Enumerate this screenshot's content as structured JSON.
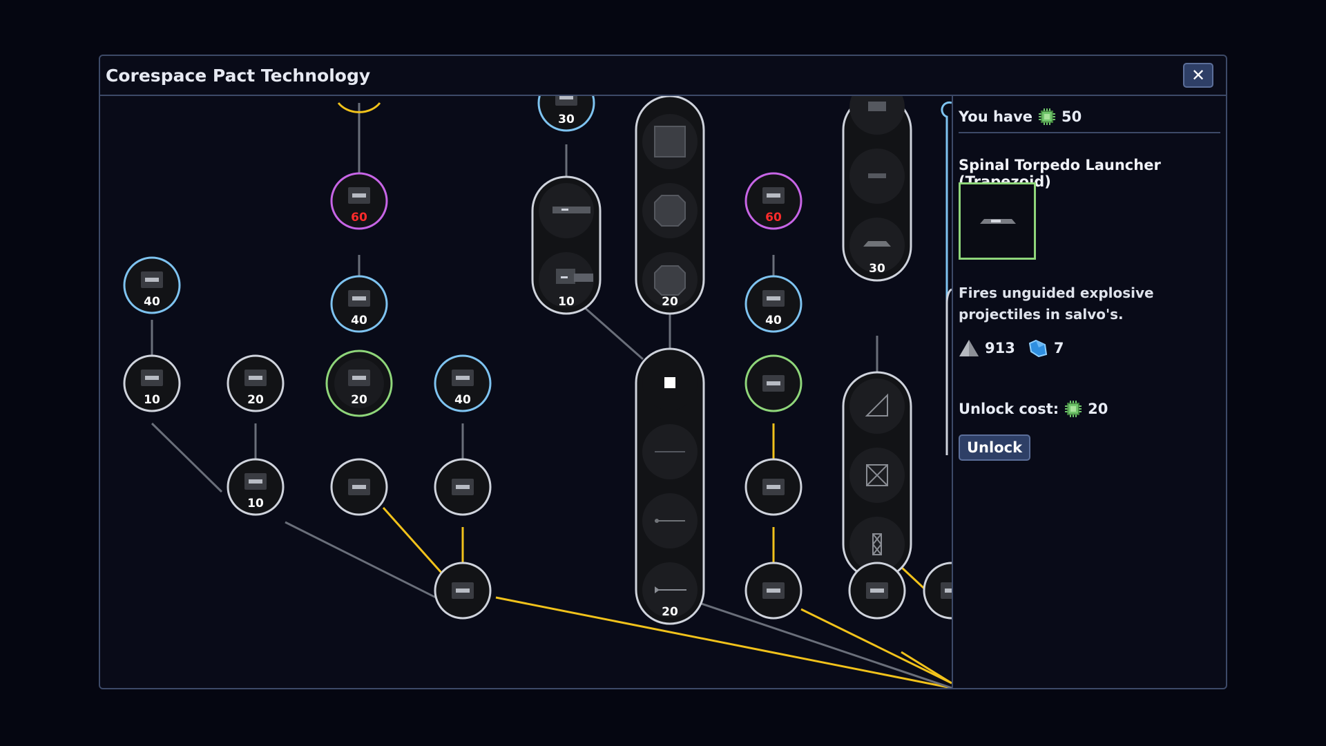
{
  "window": {
    "title": "Corespace Pact Technology",
    "close_label": "✕"
  },
  "side": {
    "you_have_label": "You have",
    "you_have_value": "50",
    "item_title": "Spinal Torpedo Launcher (Trapezoid)",
    "description": "Fires unguided explosive projectiles in salvo's.",
    "stat_mass": "913",
    "stat_crystal": "7",
    "unlock_cost_label": "Unlock cost:",
    "unlock_cost_value": "20",
    "unlock_button": "Unlock"
  },
  "tree": {
    "colors": {
      "blue": "#7ec3f0",
      "purple": "#c765e6",
      "green": "#8fd67a",
      "white": "#cfd3dc",
      "gold": "#f1c21b",
      "gray": "#6a6f7a",
      "red_cost": "#ff2b2b"
    },
    "nodes": [
      {
        "id": "n40a",
        "icon": "gun-barrel-icon",
        "cost": "40",
        "ring": "blue"
      },
      {
        "id": "n10a",
        "icon": "blaster-icon",
        "cost": "10",
        "ring": "white"
      },
      {
        "id": "n20a",
        "icon": "hex-turret-icon",
        "cost": "20",
        "ring": "white"
      },
      {
        "id": "n10b",
        "icon": "cannon-mount-icon",
        "cost": "10",
        "ring": "white"
      },
      {
        "id": "n60a",
        "icon": "heavy-turret-icon",
        "cost": "60",
        "ring": "purple",
        "cost_color": "red"
      },
      {
        "id": "n40b",
        "icon": "armored-turret-icon",
        "cost": "40",
        "ring": "blue"
      },
      {
        "id": "n20sel",
        "icon": "trapezoid-launcher-icon",
        "cost": "20",
        "ring": "green"
      },
      {
        "id": "nlaunch",
        "icon": "launcher-icon",
        "cost": "",
        "ring": "white"
      },
      {
        "id": "n40c",
        "icon": "rail-turret-icon",
        "cost": "40",
        "ring": "blue"
      },
      {
        "id": "ncannon",
        "icon": "block-cannon-icon",
        "cost": "",
        "ring": "white"
      },
      {
        "id": "nhub",
        "icon": "core-hub-icon",
        "cost": "",
        "ring": "white"
      },
      {
        "id": "n30top",
        "icon": "beam-icon",
        "cost": "30",
        "ring": "blue"
      },
      {
        "id": "n60b",
        "icon": "grate-icon",
        "cost": "60",
        "ring": "purple",
        "cost_color": "red"
      },
      {
        "id": "n40d",
        "icon": "vent-icon",
        "cost": "40",
        "ring": "blue"
      },
      {
        "id": "ngreen2",
        "icon": "bracket-icon",
        "cost": "",
        "ring": "green"
      },
      {
        "id": "nslot",
        "icon": "slot-icon",
        "cost": "",
        "ring": "white"
      },
      {
        "id": "nclamp",
        "icon": "clamp-icon",
        "cost": "",
        "ring": "white"
      },
      {
        "id": "ncross",
        "icon": "crosshair-icon",
        "cost": "",
        "ring": "white"
      },
      {
        "id": "nsquare",
        "icon": "square-icon",
        "cost": "",
        "ring": "white"
      }
    ],
    "pills": [
      {
        "id": "p-beams",
        "icons": [
          "long-beam-icon",
          "short-beam-icon"
        ],
        "cost": "10"
      },
      {
        "id": "p-armor",
        "icons": [
          "plate-square-icon",
          "plate-octagon-cross-icon",
          "plate-octagon-icon"
        ],
        "cost": "20"
      },
      {
        "id": "p-top",
        "icons": [
          "plate-icon",
          "dash-icon",
          "trapezoid-plate-icon"
        ],
        "cost": "30"
      },
      {
        "id": "p-lines",
        "icons": [
          "thin-line-icon",
          "spike-icon",
          "arrow-line-icon"
        ],
        "cost": "20"
      },
      {
        "id": "p-shapes",
        "icons": [
          "wedge-icon",
          "boxed-x-icon",
          "truss-icon"
        ],
        "cost": ""
      }
    ]
  }
}
